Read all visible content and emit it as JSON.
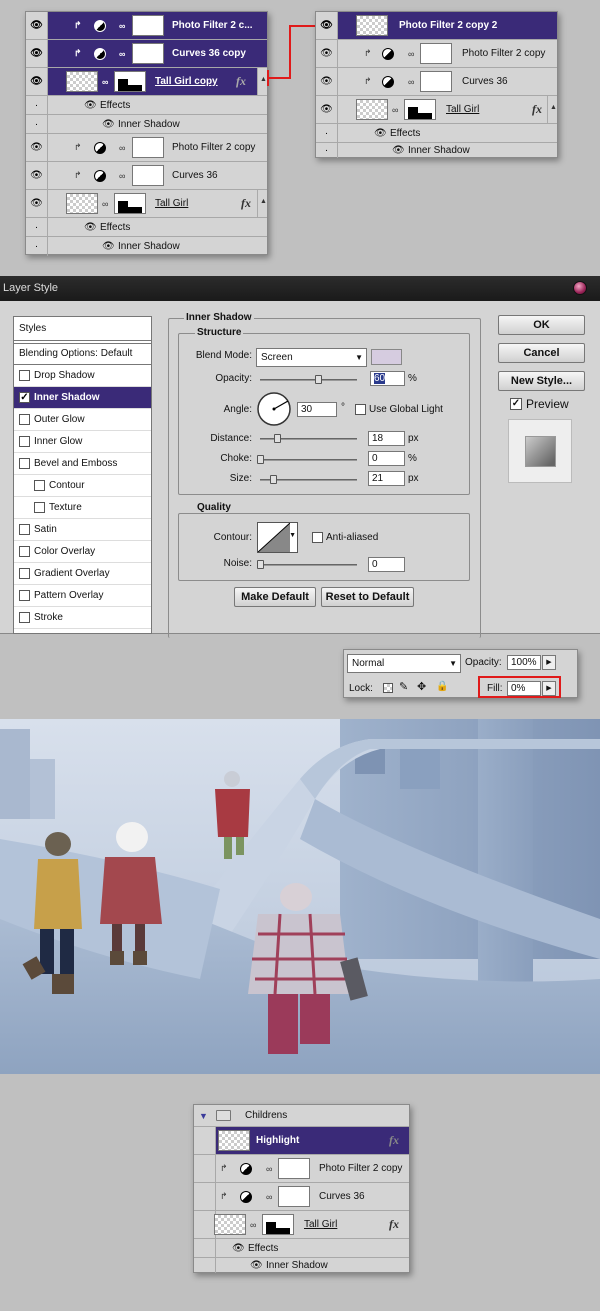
{
  "layers_panel_1": {
    "rows": [
      {
        "name": "Photo Filter 2 c...",
        "selected": true
      },
      {
        "name": "Curves 36 copy",
        "selected": true
      },
      {
        "name": "Tall Girl copy",
        "selected": true
      },
      {
        "name": "Effects"
      },
      {
        "name": "Inner Shadow"
      },
      {
        "name": "Photo Filter 2 copy"
      },
      {
        "name": "Curves 36"
      },
      {
        "name": "Tall Girl"
      },
      {
        "name": "Effects"
      },
      {
        "name": "Inner Shadow"
      }
    ],
    "fx_label": "fx"
  },
  "layers_panel_2": {
    "rows": [
      {
        "name": "Photo Filter 2 copy 2",
        "selected": true
      },
      {
        "name": "Photo Filter 2 copy"
      },
      {
        "name": "Curves 36"
      },
      {
        "name": "Tall Girl"
      },
      {
        "name": "Effects"
      },
      {
        "name": "Inner Shadow"
      }
    ],
    "fx_label": "fx"
  },
  "connector_color": "#e01a1a",
  "layer_style": {
    "title": "Layer Style",
    "styles_header": "Styles",
    "items": [
      {
        "label": "Blending Options: Default",
        "checkbox": false,
        "checked": false
      },
      {
        "label": "Drop Shadow",
        "checkbox": true,
        "checked": false
      },
      {
        "label": "Inner Shadow",
        "checkbox": true,
        "checked": true
      },
      {
        "label": "Outer Glow",
        "checkbox": true,
        "checked": false
      },
      {
        "label": "Inner Glow",
        "checkbox": true,
        "checked": false
      },
      {
        "label": "Bevel and Emboss",
        "checkbox": true,
        "checked": false
      },
      {
        "label": "Contour",
        "checkbox": true,
        "checked": false
      },
      {
        "label": "Texture",
        "checkbox": true,
        "checked": false
      },
      {
        "label": "Satin",
        "checkbox": true,
        "checked": false
      },
      {
        "label": "Color Overlay",
        "checkbox": true,
        "checked": false
      },
      {
        "label": "Gradient Overlay",
        "checkbox": true,
        "checked": false
      },
      {
        "label": "Pattern Overlay",
        "checkbox": true,
        "checked": false
      },
      {
        "label": "Stroke",
        "checkbox": true,
        "checked": false
      }
    ],
    "section_title": "Inner Shadow",
    "structure": {
      "label": "Structure",
      "blend_mode_label": "Blend Mode:",
      "blend_mode": "Screen",
      "shadow_color": "#d6cce0",
      "opacity_label": "Opacity:",
      "opacity": "60",
      "angle_label": "Angle:",
      "angle": "30",
      "degree_sign": "°",
      "use_global_light": "Use Global Light",
      "distance_label": "Distance:",
      "distance": "18",
      "choke_label": "Choke:",
      "choke": "0",
      "size_label": "Size:",
      "size": "21",
      "unit_px": "px",
      "unit_pct": "%"
    },
    "quality": {
      "label": "Quality",
      "contour_label": "Contour:",
      "anti_aliased": "Anti-aliased",
      "noise_label": "Noise:",
      "noise": "0"
    },
    "buttons": {
      "make_default": "Make Default",
      "reset_default": "Reset to Default",
      "ok": "OK",
      "cancel": "Cancel",
      "new_style": "New Style..."
    },
    "preview_label": "Preview"
  },
  "blend_bar": {
    "mode": "Normal",
    "opacity_label": "Opacity:",
    "opacity": "100%",
    "lock_label": "Lock:",
    "fill_label": "Fill:",
    "fill": "0%",
    "highlight_color": "#e01a1a"
  },
  "layers_panel_3": {
    "group_name": "Childrens",
    "rows": [
      {
        "name": "Highlight",
        "selected": true
      },
      {
        "name": "Photo Filter 2 copy"
      },
      {
        "name": "Curves 36"
      },
      {
        "name": "Tall Girl"
      },
      {
        "name": "Effects"
      },
      {
        "name": "Inner Shadow"
      }
    ],
    "fx_label": "fx"
  }
}
